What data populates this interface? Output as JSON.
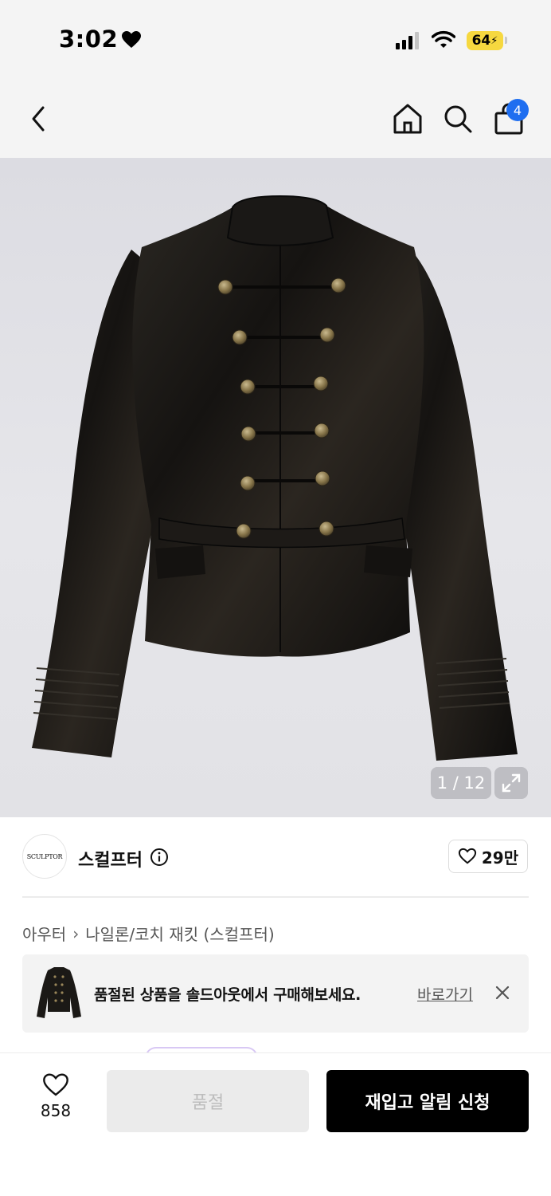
{
  "status_bar": {
    "time": "3:02",
    "battery": "64",
    "icons": [
      "heart-icon",
      "signal-icon",
      "wifi-icon",
      "battery-icon"
    ]
  },
  "nav": {
    "cart_count": "4",
    "icons": [
      "back-icon",
      "home-icon",
      "search-icon",
      "cart-icon"
    ]
  },
  "gallery": {
    "counter": "1 / 12",
    "icons": [
      "expand-icon"
    ]
  },
  "brand": {
    "logo_text": "SCULPTOR",
    "name": "스컬프터",
    "likes": "29만",
    "icons": [
      "info-icon",
      "heart-outline-icon"
    ]
  },
  "breadcrumb": {
    "items": [
      "아우터",
      "나일론/코치 재킷 (스컬프터)"
    ],
    "separator": "›"
  },
  "soldout_banner": {
    "message": "품절된 상품을 솔드아웃에서 구매해보세요.",
    "link": "바로가기",
    "icons": [
      "close-icon"
    ]
  },
  "bottom_bar": {
    "wish_count": "858",
    "soldout_label": "품절",
    "restock_label": "재입고 알림 신청"
  },
  "colors": {
    "accent": "#1e6ef0",
    "battery": "#f6d83f",
    "primary_button": "#000000",
    "disabled_button": "#ebebeb"
  }
}
